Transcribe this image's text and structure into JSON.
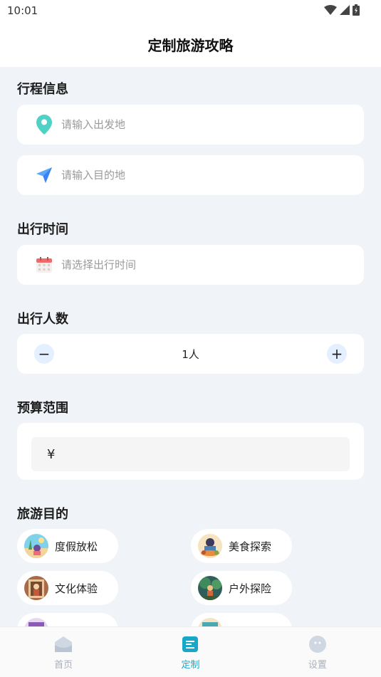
{
  "status": {
    "time": "10:01"
  },
  "header": {
    "title": "定制旅游攻略"
  },
  "trip": {
    "title": "行程信息",
    "departure_placeholder": "请输入出发地",
    "destination_placeholder": "请输入目的地"
  },
  "time": {
    "title": "出行时间",
    "placeholder": "请选择出行时间"
  },
  "people": {
    "title": "出行人数",
    "value": "1人",
    "minus": "−",
    "plus": "+"
  },
  "budget": {
    "title": "预算范围",
    "symbol": "¥"
  },
  "purpose": {
    "title": "旅游目的",
    "items": [
      {
        "label": "度假放松"
      },
      {
        "label": "美食探索"
      },
      {
        "label": "文化体验"
      },
      {
        "label": "户外探险"
      }
    ]
  },
  "tabbar": {
    "items": [
      {
        "label": "首页"
      },
      {
        "label": "定制"
      },
      {
        "label": "设置"
      }
    ]
  },
  "colors": {
    "accent": "#17a8c9",
    "background": "#f0f3f8",
    "inactive": "#a9b1bd"
  }
}
